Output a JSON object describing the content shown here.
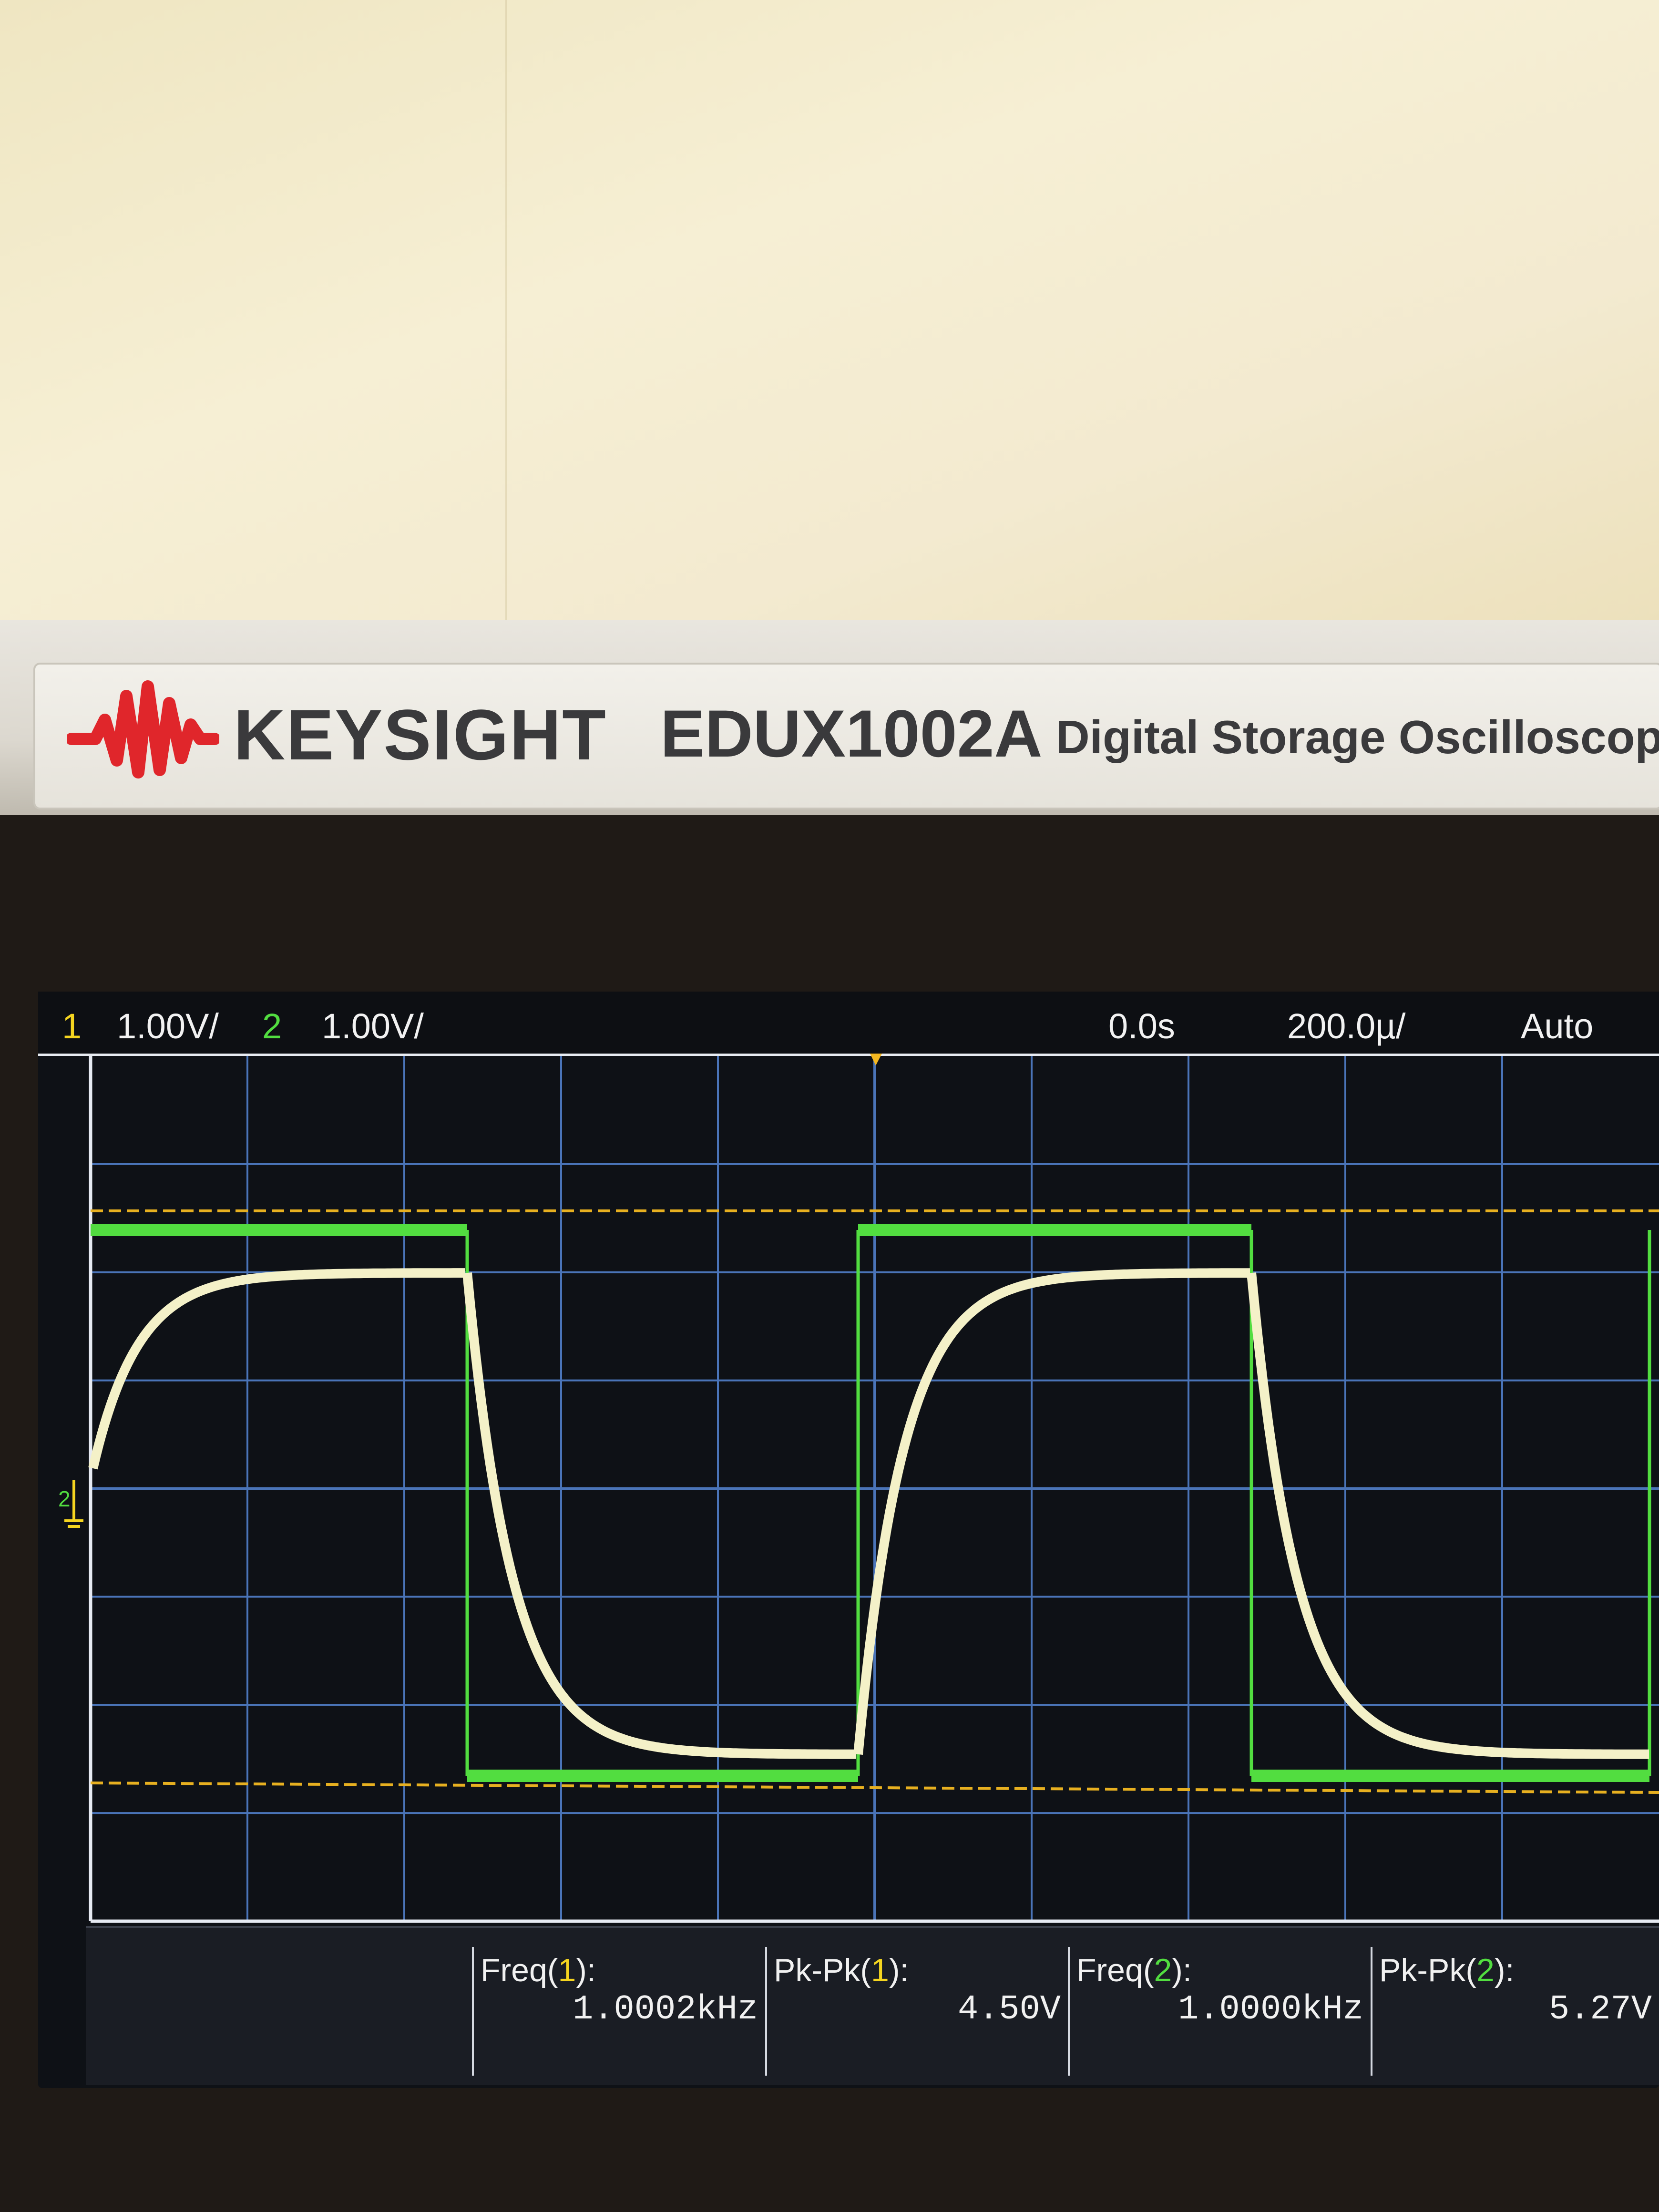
{
  "brand": {
    "name": "KEYSIGHT",
    "model": "EDUX1002A",
    "description": "Digital Storage Oscilloscope"
  },
  "status": {
    "ch1_number": "1",
    "ch1_scale": "1.00V/",
    "ch2_number": "2",
    "ch2_scale": "1.00V/",
    "time_position": "0.0s",
    "time_scale": "200.0µ/",
    "trigger_mode": "Auto"
  },
  "ground_marker": "2",
  "measurements": [
    {
      "label": "Freq(",
      "channel": "1",
      "close": "):",
      "value": "1.0002kHz"
    },
    {
      "label": "Pk-Pk(",
      "channel": "1",
      "close": "):",
      "value": "4.50V"
    },
    {
      "label": "Freq(",
      "channel": "2",
      "close": "):",
      "value": "1.0000kHz"
    },
    {
      "label": "Pk-Pk(",
      "channel": "2",
      "close": "):",
      "value": "5.27V"
    }
  ],
  "colors": {
    "channel1": "#f5d520",
    "channel2": "#52dd40",
    "grid": "#4a74b8",
    "trace_rc": "#f4f1c8"
  },
  "chart_data": {
    "type": "line",
    "series": [
      {
        "waveform": "square",
        "frequency_khz": 1.0,
        "peak_to_peak_v": 5.27
      },
      {
        "waveform": "rc-charging",
        "frequency_khz": 1.0002,
        "peak_to_peak_v": 4.5
      }
    ]
  }
}
